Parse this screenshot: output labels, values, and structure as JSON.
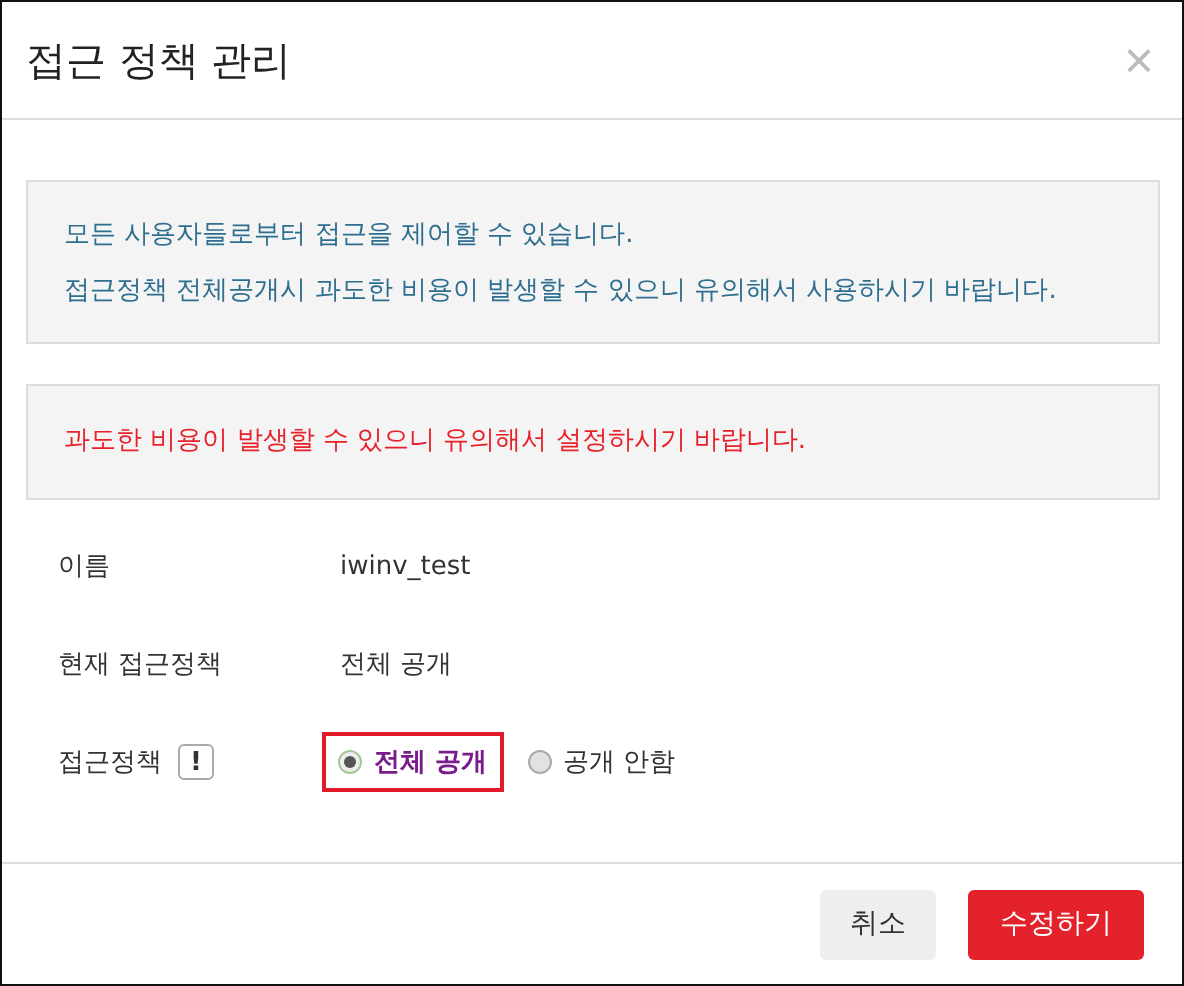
{
  "dialog": {
    "title": "접근 정책 관리",
    "close": "×"
  },
  "info_notes": [
    "모든 사용자들로부터 접근을 제어할 수 있습니다.",
    "접근정책 전체공개시 과도한 비용이 발생할 수 있으니 유의해서 사용하시기 바랍니다."
  ],
  "warning_note": "과도한 비용이 발생할 수 있으니 유의해서 설정하시기 바랍니다.",
  "fields": [
    {
      "kind": "text",
      "label": "이름",
      "value": "iwinv_test"
    },
    {
      "kind": "text",
      "label": "현재 접근정책",
      "value": "전체 공개"
    },
    {
      "kind": "radio",
      "label": "접근정책",
      "hint": "!",
      "options": [
        {
          "label": "전체 공개",
          "selected": true,
          "highlighted": true
        },
        {
          "label": "공개 안함",
          "selected": false,
          "highlighted": false
        }
      ]
    }
  ],
  "buttons": [
    {
      "kind": "secondary",
      "label": "취소"
    },
    {
      "kind": "primary",
      "label": "수정하기"
    }
  ]
}
